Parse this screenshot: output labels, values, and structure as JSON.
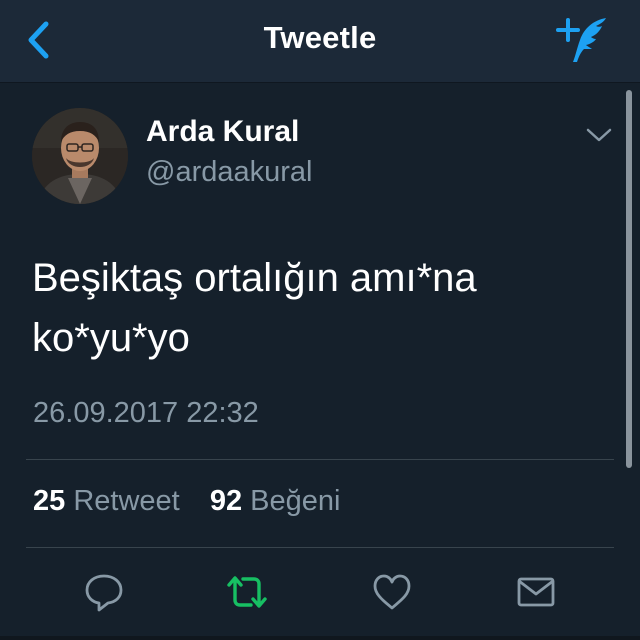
{
  "navbar": {
    "title": "Tweetle",
    "back_icon": "chevron-left-icon",
    "compose_icon": "compose-tweet-icon"
  },
  "tweet": {
    "author_name": "Arda Kural",
    "author_handle": "@ardaakural",
    "text_line1": "Beşiktaş ortalığın amı*na",
    "text_line2": "ko*yu*yo",
    "timestamp": "26.09.2017 22:32",
    "retweet_count": "25",
    "retweet_label": "Retweet",
    "like_count": "92",
    "like_label": "Beğeni"
  },
  "actions": {
    "reply_icon": "reply-icon",
    "retweet_icon": "retweet-icon",
    "like_icon": "heart-icon",
    "dm_icon": "envelope-icon"
  },
  "colors": {
    "background": "#15202b",
    "navbar": "#1c2938",
    "accent_blue": "#1da1f2",
    "retweet_green": "#17bf63",
    "secondary_text": "#8899a6",
    "divider": "#38444d"
  }
}
